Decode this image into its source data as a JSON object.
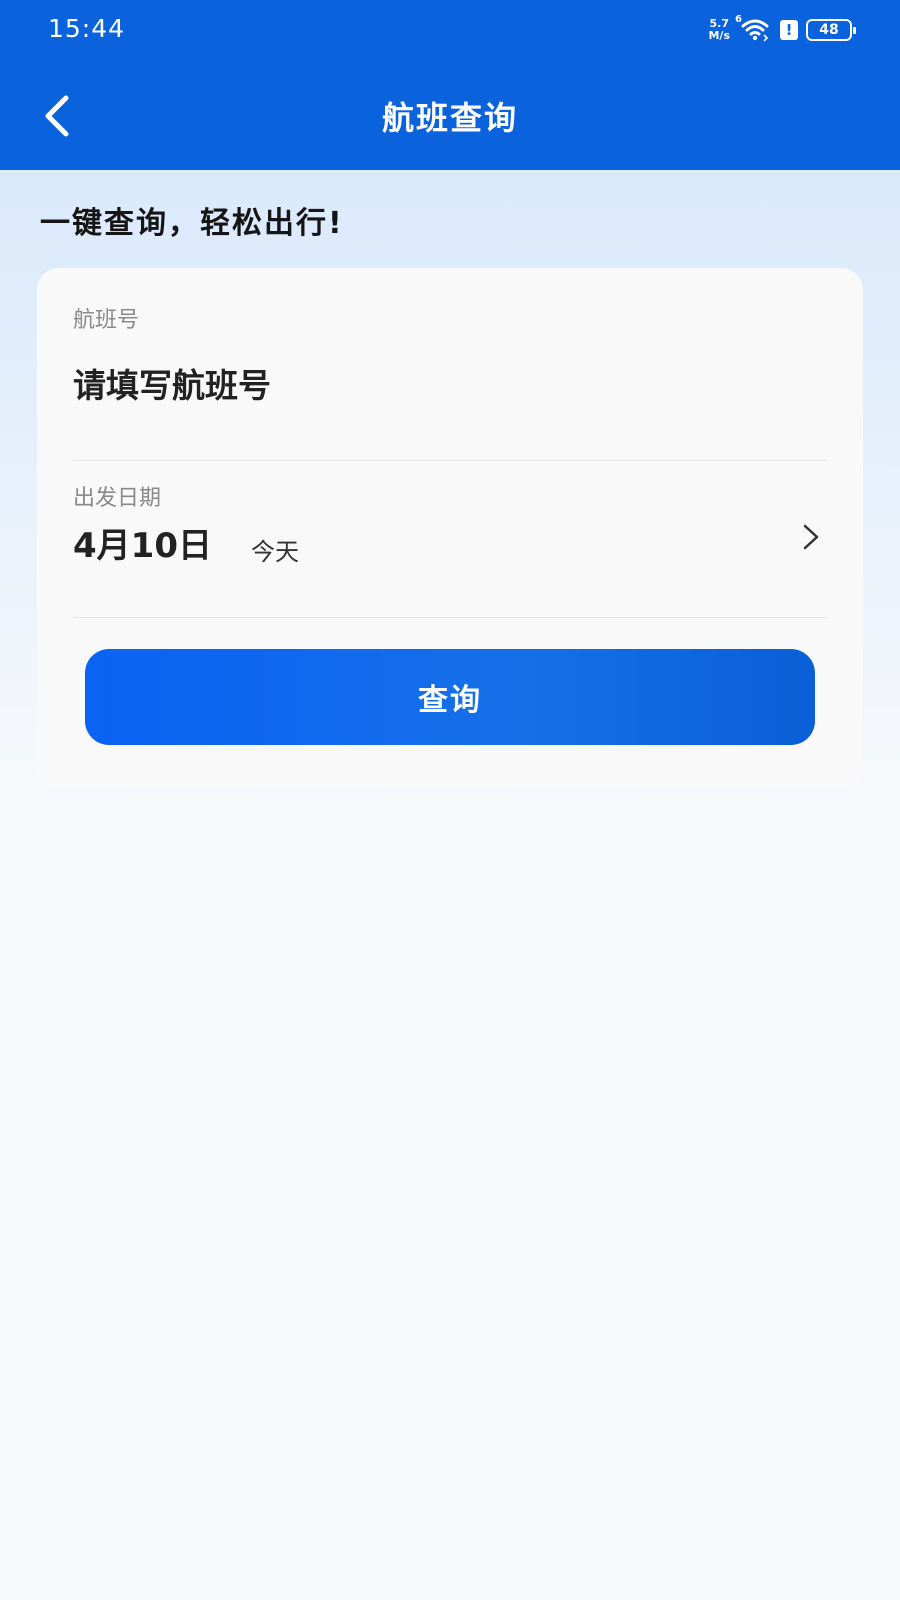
{
  "status_bar": {
    "time": "15:44",
    "speed_value": "5.7",
    "speed_unit": "M/s",
    "wifi_sub": "6",
    "battery": "48"
  },
  "header": {
    "title": "航班查询",
    "back_icon": "chevron-left-icon"
  },
  "slogan": "一键查询，轻松出行!",
  "form": {
    "flight_label": "航班号",
    "flight_placeholder": "请填写航班号",
    "date_label": "出发日期",
    "date_value": "4月10日",
    "date_hint": "今天",
    "submit_label": "查询"
  },
  "colors": {
    "header_bg": "#0a62dd",
    "button_start": "#0a63f3",
    "button_end": "#0a5fd7"
  }
}
